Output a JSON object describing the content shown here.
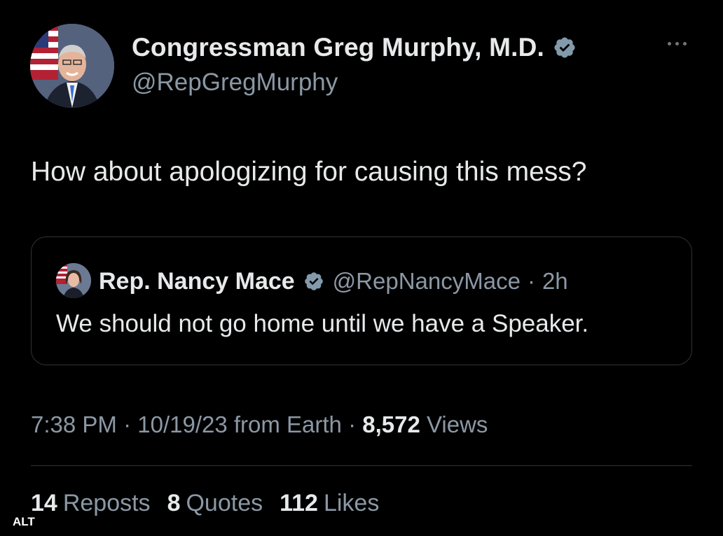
{
  "tweet": {
    "author": {
      "display_name": "Congressman Greg Murphy, M.D.",
      "handle": "@RepGregMurphy",
      "verified_icon": "verified-badge-icon"
    },
    "text": "How about apologizing for causing this mess?",
    "quoted_tweet": {
      "author": {
        "display_name": "Rep. Nancy Mace",
        "handle": "@RepNancyMace",
        "separator": "·",
        "time": "2h"
      },
      "text": "We should not go home until we have a Speaker."
    },
    "meta": {
      "time": "7:38 PM",
      "sep1": " · ",
      "date": "10/19/23 from Earth",
      "sep2": " · ",
      "views_count": "8,572",
      "views_label": " Views"
    },
    "stats": {
      "reposts_count": "14",
      "reposts_label": "Reposts",
      "quotes_count": "8",
      "quotes_label": "Quotes",
      "likes_count": "112",
      "likes_label": "Likes"
    }
  },
  "overlay": {
    "alt_label": "ALT"
  },
  "colors": {
    "background": "#000000",
    "text_primary": "#e7e9ea",
    "text_secondary": "#8b98a5",
    "verified": "#829aab",
    "border": "#2f3336"
  }
}
